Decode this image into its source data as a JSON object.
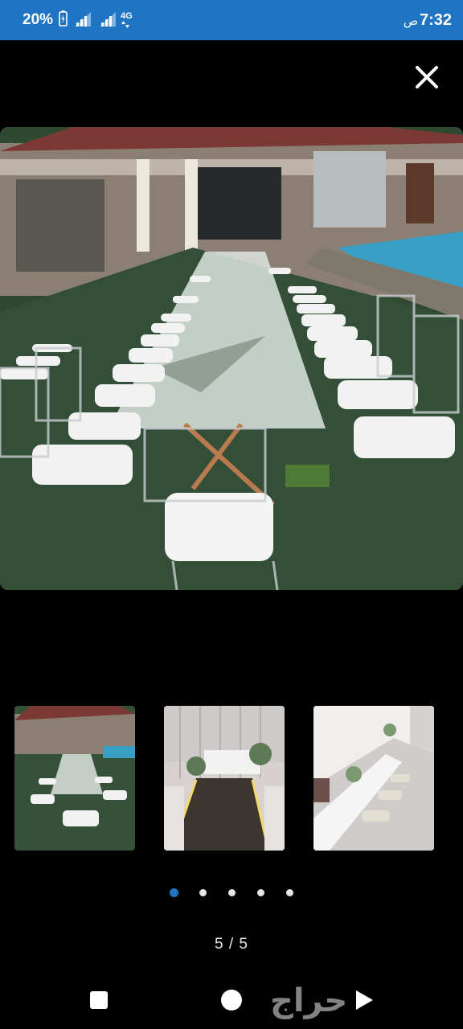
{
  "status_bar": {
    "battery_percent": "20%",
    "network_label": "4G",
    "time": "7:32",
    "ampm": "ص",
    "color": "#1f74c4"
  },
  "viewer": {
    "close_icon": "close-icon",
    "counter": "5 / 5",
    "current_index": 5,
    "total": 5,
    "thumbnails": [
      {
        "subject": "outdoor poolside table"
      },
      {
        "subject": "stage with flowers"
      },
      {
        "subject": "indoor banquet hall"
      }
    ]
  },
  "nav_bar": {
    "brand_logo_text": "حراج",
    "icons": [
      "recents-square-icon",
      "home-circle-icon",
      "back-triangle-icon"
    ]
  }
}
